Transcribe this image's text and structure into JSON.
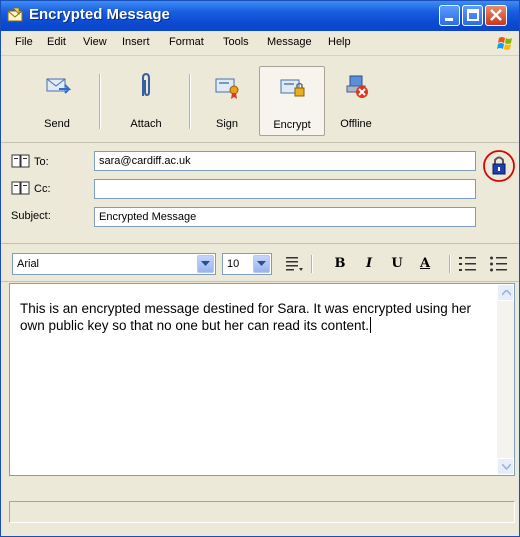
{
  "window": {
    "title": "Encrypted Message"
  },
  "menu": {
    "items": [
      "File",
      "Edit",
      "View",
      "Insert",
      "Format",
      "Tools",
      "Message",
      "Help"
    ]
  },
  "toolbar": {
    "send_label": "Send",
    "attach_label": "Attach",
    "sign_label": "Sign",
    "encrypt_label": "Encrypt",
    "encrypt_pressed": true,
    "offline_label": "Offline"
  },
  "header": {
    "to_label": "To:",
    "to_value": "sara@cardiff.ac.uk",
    "cc_label": "Cc:",
    "cc_value": "",
    "subject_label": "Subject:",
    "subject_value": "Encrypted Message",
    "encryption_indicator_icon": "lock-icon",
    "indicator_highlight_color": "#e00000"
  },
  "format": {
    "font_name": "Arial",
    "font_size": "10",
    "bold_label": "B",
    "italic_label": "I",
    "underline_label": "U",
    "font_color_label": "A"
  },
  "body": {
    "text": "This is an encrypted message destined for Sara. It was encrypted using her own public key so that no one but her can read its content."
  },
  "colors": {
    "titlebar": "#0a45c8",
    "window_bg": "#ece9d8",
    "close_button": "#c8391c"
  }
}
